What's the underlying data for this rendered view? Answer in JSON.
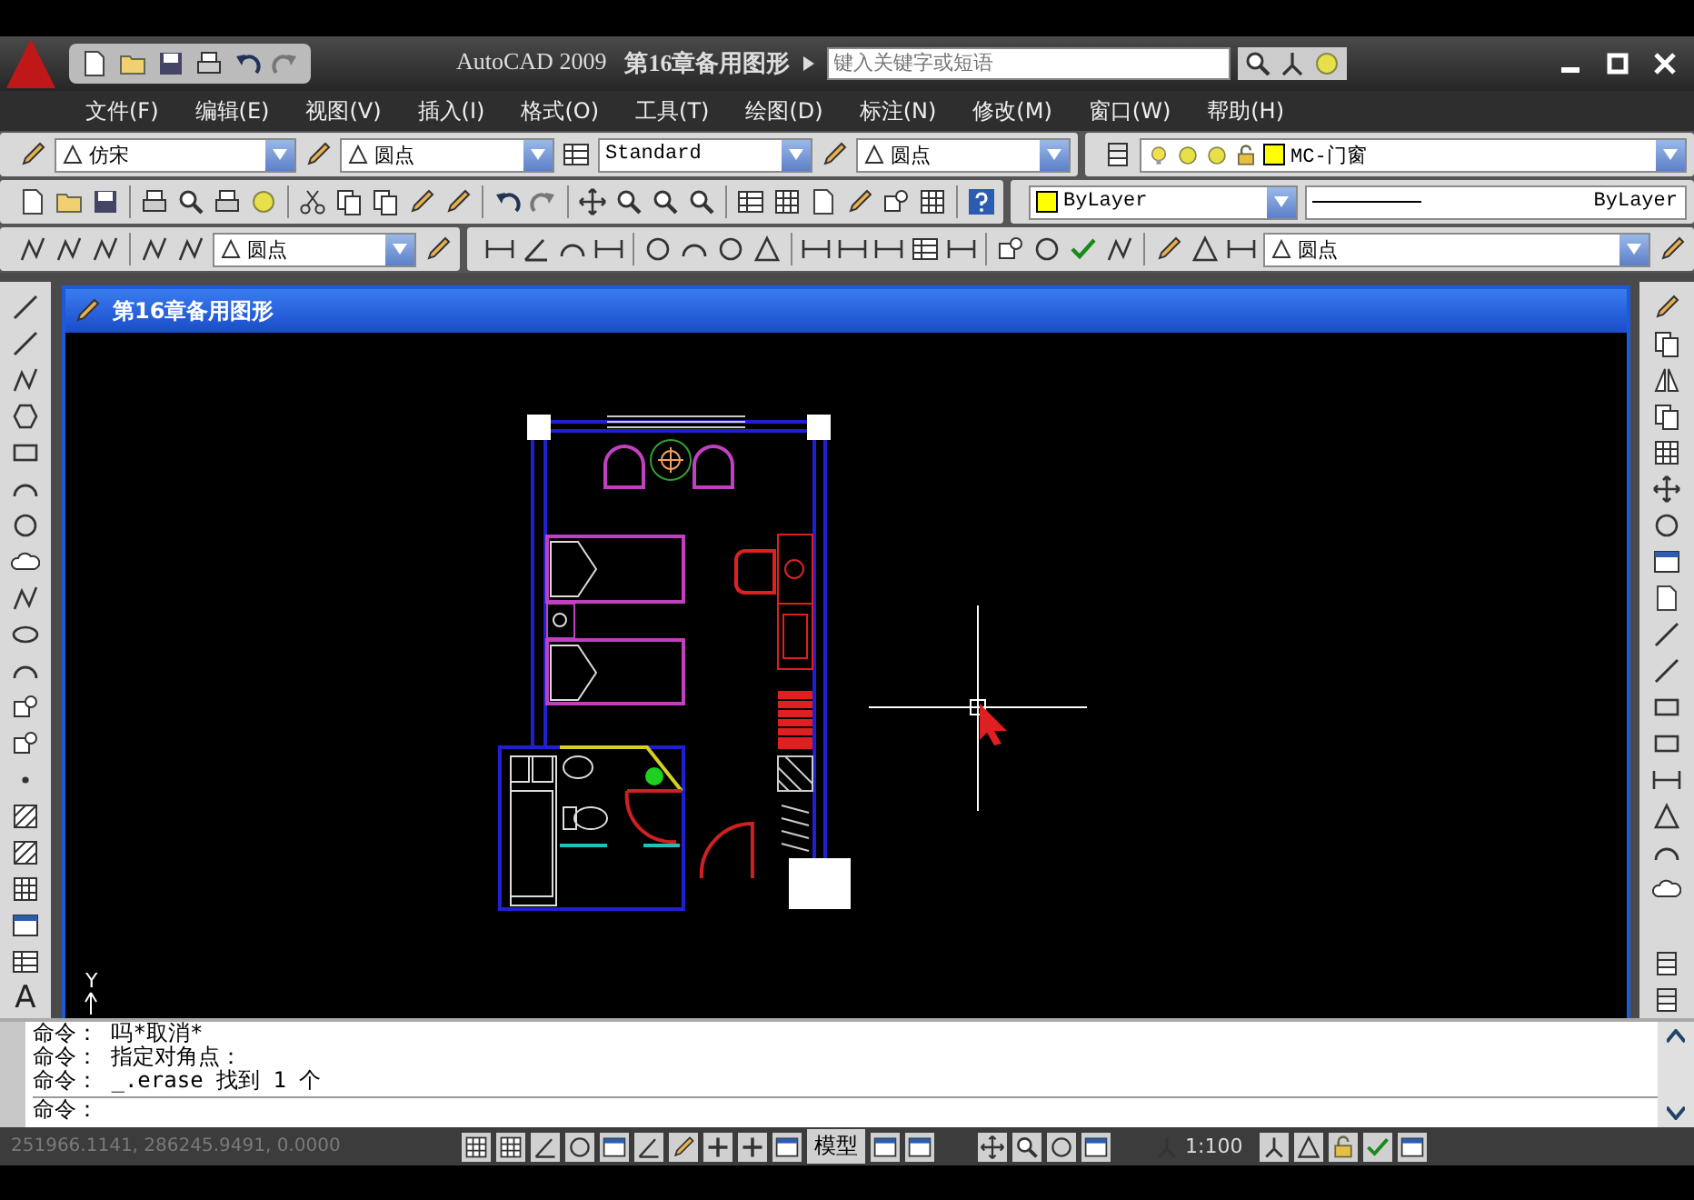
{
  "app_title": "AutoCAD 2009",
  "document_title": "第16章备用图形",
  "search": {
    "placeholder": "键入关键字或短语"
  },
  "menu": [
    "文件(F)",
    "编辑(E)",
    "视图(V)",
    "插入(I)",
    "格式(O)",
    "工具(T)",
    "绘图(D)",
    "标注(N)",
    "修改(M)",
    "窗口(W)",
    "帮助(H)"
  ],
  "styles_toolbar": {
    "text_style": "仿宋",
    "dimension_style": "圆点",
    "table_style": "Standard",
    "multileader_style": "圆点"
  },
  "layers_toolbar": {
    "layer": "MC-门窗"
  },
  "properties_toolbar": {
    "color_label": "ByLayer",
    "linetype": "ByLayer"
  },
  "third_toolbar": {
    "leader_style": "圆点",
    "dimension_style": "圆点"
  },
  "drawing_window": {
    "title": "第16章备用图形",
    "ucs_label": "Y"
  },
  "left_toolbar": {
    "text_glyph": "A"
  },
  "command_window": {
    "history": [
      "命令： 吗*取消*",
      "命令： 指定对角点：",
      "命令： _.erase 找到 1 个"
    ],
    "prompt": "命令："
  },
  "status_bar": {
    "coordinates": "251966.1141, 286245.9491, 0.0000",
    "model_label": "模型",
    "scale": "1:100"
  }
}
